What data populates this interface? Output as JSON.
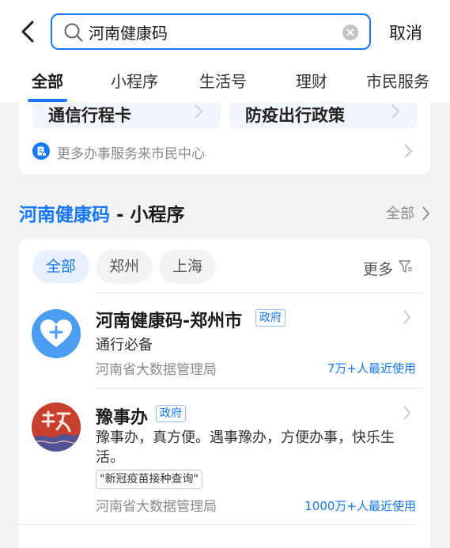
{
  "search": {
    "value": "河南健康码",
    "cancel_label": "取消"
  },
  "tabs": [
    {
      "label": "全部",
      "active": true
    },
    {
      "label": "小程序",
      "active": false
    },
    {
      "label": "生活号",
      "active": false
    },
    {
      "label": "理财",
      "active": false
    },
    {
      "label": "市民服务",
      "active": false
    }
  ],
  "policy_tiles": [
    "通信行程卡",
    "防疫出行政策"
  ],
  "more_services": {
    "icon": "document-icon",
    "label": "更多办事服务来市民中心"
  },
  "section": {
    "title_highlight": "河南健康码",
    "title_suffix": " - 小程序",
    "all_label": "全部"
  },
  "filters": {
    "chips": [
      {
        "label": "全部",
        "active": true
      },
      {
        "label": "郑州",
        "active": false
      },
      {
        "label": "上海",
        "active": false
      }
    ],
    "more_label": "更多"
  },
  "results": [
    {
      "title": "河南健康码-郑州市",
      "badge": "政府",
      "description": "通行必备",
      "org": "河南省大数据管理局",
      "usage": "7万+人最近使用",
      "icon": "heart-plus-icon"
    },
    {
      "title": "豫事办",
      "badge": "政府",
      "description": "豫事办，真方便。遇事豫办，方便办事，快乐生活。",
      "tag": "\"新冠疫苗接种查询\"",
      "org": "河南省大数据管理局",
      "usage": "1000万+人最近使用",
      "icon": "yu-seal-icon"
    }
  ],
  "colors": {
    "accent": "#1677ff",
    "page_bg": "#f2f3f5",
    "card_bg": "#ffffff",
    "muted": "#8a8a8a"
  }
}
